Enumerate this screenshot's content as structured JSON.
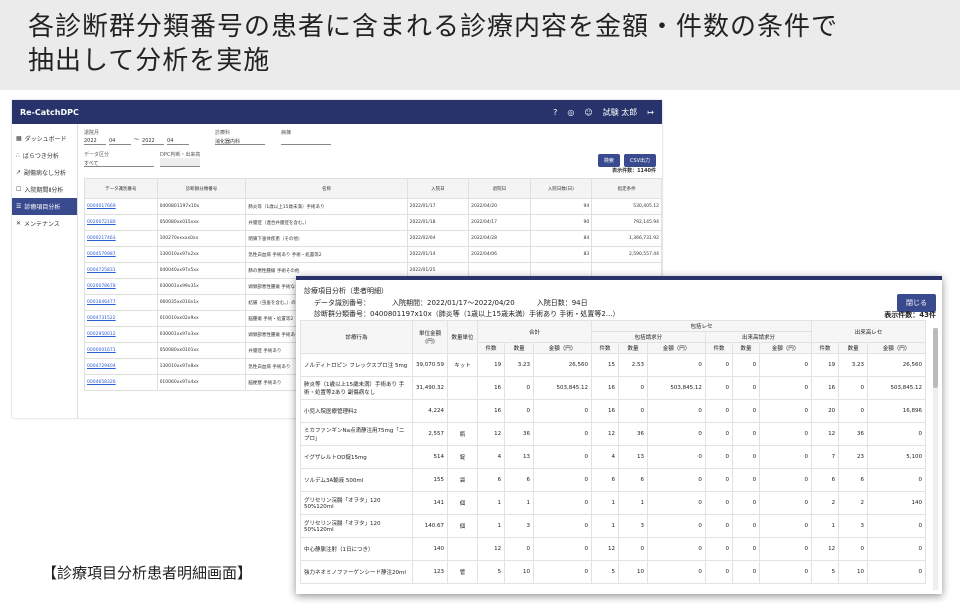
{
  "slide": {
    "title_line1": "各診断群分類番号の患者に含まれる診療内容を金額・件数の条件で",
    "title_line2": "抽出して分析を実施",
    "caption": "【診療項目分析患者明細画面】"
  },
  "app": {
    "logo": "Re-CatchDPC",
    "user": "試験 太郎",
    "sidebar": [
      "ダッシュボード",
      "ばらつき分析",
      "副傷病なし分析",
      "入院期間Ⅱ分析",
      "診療項目分析",
      "メンテナンス"
    ],
    "filters": {
      "period_label": "退院月",
      "from_year": "2022",
      "from_month": "04",
      "to_year": "2022",
      "to_month": "04",
      "dept_label": "診療科",
      "dept_value": "消化器内科",
      "ward_label": "病棟",
      "data_label": "データ区分",
      "data_value": "すべて",
      "dpc_label": "DPC判断・出来高",
      "search_btn": "検索",
      "csv_btn": "CSV出力",
      "count": "表示件数：1140件"
    },
    "table_headers": [
      "データ識別番号",
      "診断群分類番号",
      "名称",
      "入院日",
      "退院日",
      "入院日数(日)",
      "指定条件"
    ],
    "rows": [
      {
        "id": "0004017669",
        "dpc": "0400801197x10x",
        "name": "肺炎等（1歳以上15歳未満）手術あり",
        "in": "2022/01/17",
        "out": "2022/04/20",
        "days": "94",
        "val": "530,405.12"
      },
      {
        "id": "0020072180",
        "dpc": "050080xx015xxx",
        "name": "弁膜症（連合弁膜症を含む。）",
        "in": "2022/01/18",
        "out": "2022/04/17",
        "days": "90",
        "val": "792,145.94"
      },
      {
        "id": "0000217463",
        "dpc": "100270xxxxx0xx",
        "name": "閉鎖下垂体疾患（その他）",
        "in": "2022/02/04",
        "out": "2022/04/28",
        "days": "84",
        "val": "1,366,731.92"
      },
      {
        "id": "0004570987",
        "dpc": "130010xx97x2xx",
        "name": "急性白血病 手術あり 手術・処置等2",
        "in": "2022/01/14",
        "out": "2022/04/06",
        "days": "83",
        "val": "2,590,557.44"
      },
      {
        "id": "0004725831",
        "dpc": "040040xx97x5xx",
        "name": "肺の悪性腫瘍 手術その他",
        "in": "2022/01/25",
        "out": "",
        "days": "",
        "val": ""
      },
      {
        "id": "0020078678",
        "dpc": "030001xx99x31x",
        "name": "頭頸部悪性腫瘍 手術なし",
        "in": "2022/01/18",
        "out": "",
        "days": "",
        "val": ""
      },
      {
        "id": "0001646477",
        "dpc": "060035xx010x1x",
        "name": "結腸（虫垂を含む。）の悪性腫瘍",
        "in": "2022/02/15",
        "out": "",
        "days": "",
        "val": ""
      },
      {
        "id": "0004731522",
        "dpc": "010010xx02x9xx",
        "name": "脳腫瘍 手術・処置等2",
        "in": "2022/01/29",
        "out": "",
        "days": "",
        "val": ""
      },
      {
        "id": "0002950012",
        "dpc": "030001xx97x3xx",
        "name": "頭頸部悪性腫瘍 手術あり",
        "in": "2022/03/01",
        "out": "",
        "days": "",
        "val": ""
      },
      {
        "id": "0000001671",
        "dpc": "050080xx0101xx",
        "name": "弁膜症 手術あり",
        "in": "2022/01/18",
        "out": "",
        "days": "",
        "val": ""
      },
      {
        "id": "0004729404",
        "dpc": "130010xx97x8xx",
        "name": "急性白血病 手術あり",
        "in": "2022/02/24",
        "out": "",
        "days": "",
        "val": ""
      },
      {
        "id": "0004658326",
        "dpc": "010060xx97x4xx",
        "name": "脳梗塞 手術あり",
        "in": "2022/03/02",
        "out": "",
        "days": "",
        "val": ""
      }
    ]
  },
  "modal": {
    "title": "診療項目分析（患者明細）",
    "data_id_label": "データ識別番号：",
    "period": "入院期間：2022/01/17～2022/04/20",
    "days": "入院日数：94日",
    "dpc": "診断群分類番号：0400801197x10x（肺炎等（1歳以上15歳未満）手術あり 手術・処置等2...）",
    "close_btn": "閉じる",
    "count": "表示件数：43件",
    "headers": {
      "item": "診療行為",
      "unit_price": "単位金額(円)",
      "unit": "数量単位",
      "total": "合計",
      "hokatsu": "包括レセ",
      "dekidaka": "出来高レセ",
      "hokatsu_a": "包括請求分",
      "hokatsu_b": "出来高請求分",
      "ken": "件数",
      "qty": "数量",
      "amt": "金額（円）"
    },
    "rows": [
      {
        "item": "ノルディトロピン フレックスプロ注 5mg",
        "price": "39,070.59",
        "unit": "キット",
        "v": [
          "19",
          "3.23",
          "26,560",
          "15",
          "2.53",
          "0",
          "0",
          "0",
          "0",
          "19",
          "3.23",
          "26,560"
        ]
      },
      {
        "item": "肺炎等（1歳以上15歳未満）手術あり 手術・処置等2あり 副傷病なし",
        "price": "31,490.32",
        "unit": "",
        "v": [
          "16",
          "0",
          "503,845.12",
          "16",
          "0",
          "503,845.12",
          "0",
          "0",
          "0",
          "16",
          "0",
          "503,845.12"
        ]
      },
      {
        "item": "小児入院医療管理料2",
        "price": "4,224",
        "unit": "",
        "v": [
          "16",
          "0",
          "0",
          "16",
          "0",
          "0",
          "0",
          "0",
          "0",
          "20",
          "0",
          "16,896"
        ]
      },
      {
        "item": "ミカファンギンNa点滴静注用75mg「ニプロ」",
        "price": "2,557",
        "unit": "瓶",
        "v": [
          "12",
          "36",
          "0",
          "12",
          "36",
          "0",
          "0",
          "0",
          "0",
          "12",
          "36",
          "0"
        ]
      },
      {
        "item": "イグザレルトOD錠15mg",
        "price": "514",
        "unit": "錠",
        "v": [
          "4",
          "13",
          "0",
          "4",
          "13",
          "0",
          "0",
          "0",
          "0",
          "7",
          "23",
          "5,100"
        ]
      },
      {
        "item": "ソルデム3A輸液 500ml",
        "price": "155",
        "unit": "袋",
        "v": [
          "6",
          "6",
          "0",
          "6",
          "6",
          "0",
          "0",
          "0",
          "0",
          "6",
          "6",
          "0"
        ]
      },
      {
        "item": "グリセリン浣腸「オヲタ」120 50%120ml",
        "price": "141",
        "unit": "個",
        "v": [
          "1",
          "1",
          "0",
          "1",
          "1",
          "0",
          "0",
          "0",
          "0",
          "2",
          "2",
          "140"
        ]
      },
      {
        "item": "グリセリン浣腸「オヲタ」120 50%120ml",
        "price": "140.67",
        "unit": "個",
        "v": [
          "1",
          "3",
          "0",
          "1",
          "3",
          "0",
          "0",
          "0",
          "0",
          "1",
          "3",
          "0"
        ]
      },
      {
        "item": "中心静脈注射（1日につき）",
        "price": "140",
        "unit": "",
        "v": [
          "12",
          "0",
          "0",
          "12",
          "0",
          "0",
          "0",
          "0",
          "0",
          "12",
          "0",
          "0"
        ]
      },
      {
        "item": "強力ネオミノファーゲンシード静注20ml",
        "price": "123",
        "unit": "管",
        "v": [
          "5",
          "10",
          "0",
          "5",
          "10",
          "0",
          "0",
          "0",
          "0",
          "5",
          "10",
          "0"
        ]
      }
    ]
  }
}
